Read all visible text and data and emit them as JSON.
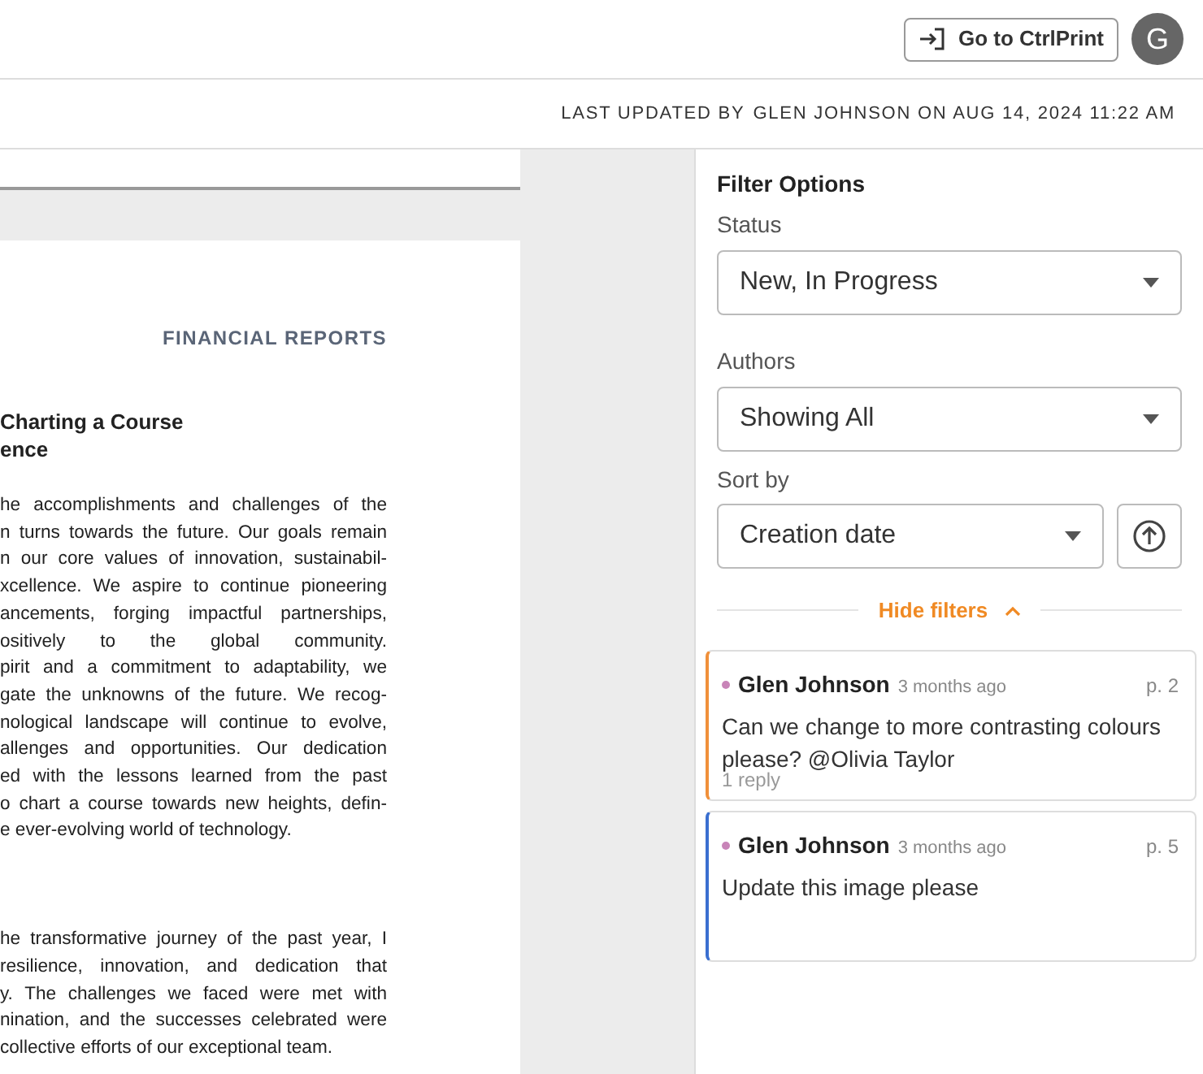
{
  "header": {
    "button": "Go to CtrlPrint",
    "avatar": "G"
  },
  "meta_bar": {
    "label": "LAST UPDATED BY",
    "value": "GLEN JOHNSON ON AUG 14, 2024 11:22 AM"
  },
  "document": {
    "section_label": "FINANCIAL REPORTS",
    "title_lines": [
      "Charting a Course",
      "ence"
    ],
    "paragraphs": [
      [
        "he accomplishments and challenges of the",
        "n turns towards the future. Our goals remain",
        "n our core values of innovation, sustainabil-",
        "xcellence. We aspire to continue pioneering",
        "ancements, forging impactful partnerships,",
        "ositively to the global community.",
        "pirit and a commitment to adaptability, we",
        "gate the unknowns of the future. We recog-",
        "nological landscape will continue to evolve,",
        "allenges and opportunities. Our dedication",
        "ed with the lessons learned from the past",
        "o chart a course towards new heights, defin-",
        "e ever-evolving world of technology."
      ],
      [
        "he transformative journey of the past year, I",
        "resilience, innovation, and dedication that",
        "y. The challenges we faced were met with",
        "nination, and the successes celebrated were",
        "collective efforts of our exceptional team."
      ]
    ]
  },
  "filters": {
    "title": "Filter Options",
    "fields": [
      {
        "label": "Status",
        "value": "New, In Progress"
      },
      {
        "label": "Authors",
        "value": "Showing All"
      }
    ],
    "sort": {
      "label": "Sort by",
      "value": "Creation date"
    },
    "toggle": "Hide filters"
  },
  "comments": [
    {
      "author": "Glen Johnson",
      "time": "3 months ago",
      "page": "p. 2",
      "text": "Can we change to more contrasting colours please? @Olivia Taylor",
      "replies": "1 reply",
      "color": "#f0903a"
    },
    {
      "author": "Glen Johnson",
      "time": "3 months ago",
      "page": "p. 5",
      "text": "Update this image please",
      "color": "#3a6fd0"
    }
  ]
}
